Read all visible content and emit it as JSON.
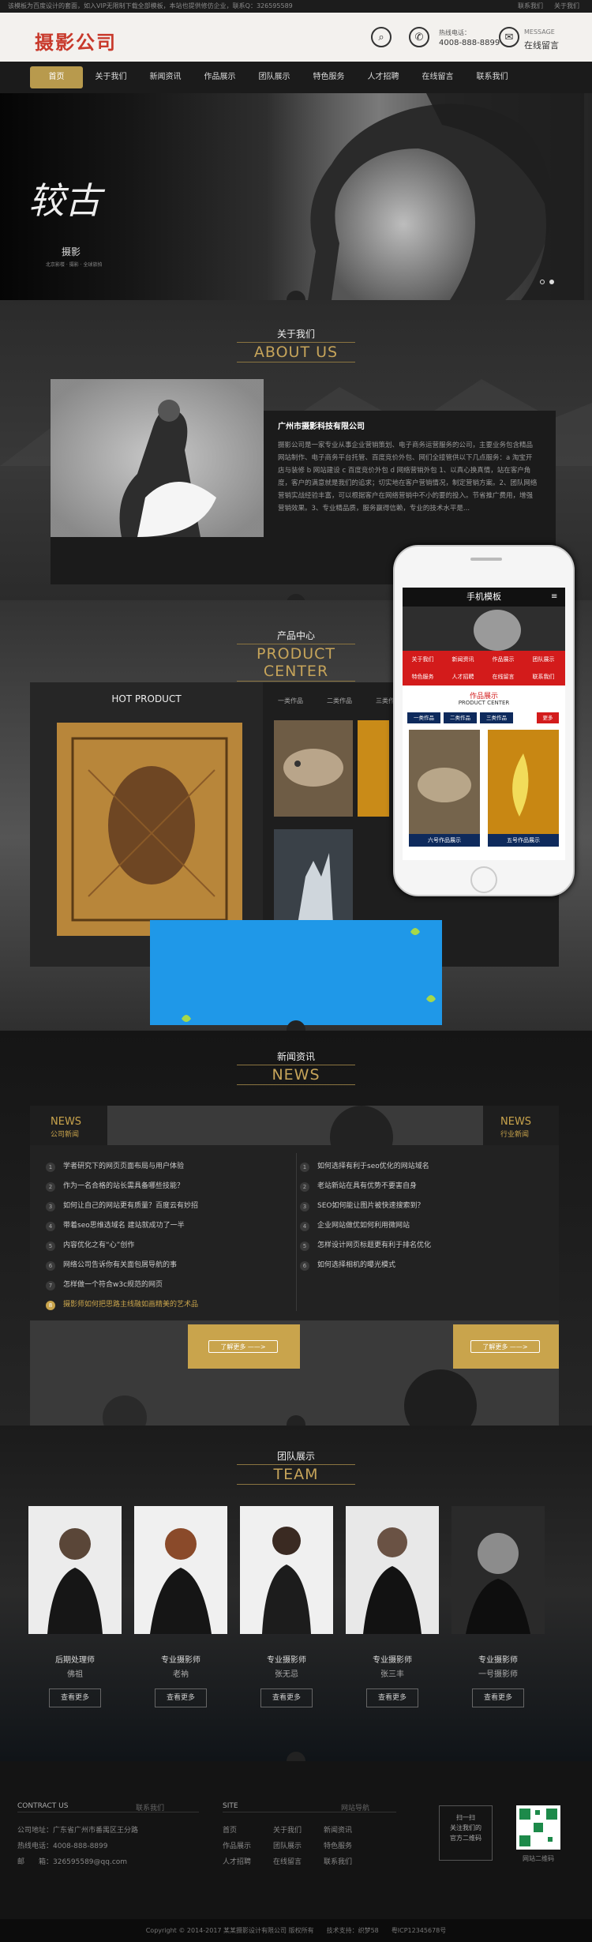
{
  "topbar": {
    "notice": "该模板为百度设计的套面，如入VIP无限制下载全部模板，本站也提供修仿企业，联系Q：326595589",
    "links": [
      "联系我们",
      "关于我们"
    ]
  },
  "header": {
    "logo": "摄影公司",
    "hotline_label": "热线电话：",
    "hotline": "4008-888-8899",
    "message_en": "MESSAGE",
    "message_cn": "在线留言"
  },
  "nav": [
    "首页",
    "关于我们",
    "新闻资讯",
    "作品展示",
    "团队展示",
    "特色服务",
    "人才招聘",
    "在线留言",
    "联系我们"
  ],
  "banner": {
    "calligraphy": "较古",
    "brand": "摄影",
    "sub": "北京影楼 · 摄影 · 全球旅拍"
  },
  "about": {
    "title_cn": "关于我们",
    "title_en": "ABOUT US",
    "company": "广州市摄影科技有限公司",
    "text": "摄影公司是一家专业从事企业营销策划、电子商务运营服务的公司，主要业务包含精品网站制作、电子商务平台托管、百度竞价外包、网们全接管供以下几点服务：a 淘宝开店与装修 b 网站建设 c 百度竞价外包 d 网络营销外包 1、以真心换真情，站在客户角度，客户的满意就是我们的追求；切实地在客户营销情况，制定营销方案。2、团队网络营销实战经验丰富，可以根据客户在网络营销中不小的要的投入。节省推广费用，增强营销效果。3、专业精品质，服务赢得信赖，专业的技术水平是..."
  },
  "products": {
    "title_cn": "产品中心",
    "title_en": "PRODUCT CENTER",
    "hot": "HOT PRODUCT",
    "tabs": [
      "一类作品",
      "二类作品",
      "三类作品"
    ]
  },
  "phone": {
    "title": "手机模板",
    "menu": [
      "关于我们",
      "新闻资讯",
      "作品展示",
      "团队展示",
      "特色服务",
      "人才招聘",
      "在线留言",
      "联系我们"
    ],
    "sec_cn": "作品展示",
    "sec_en": "PRODUCT CENTER",
    "tabs": [
      "一类作品",
      "二类作品",
      "三类作品",
      "更多"
    ],
    "captions": [
      "六号作品展示",
      "五号作品展示"
    ]
  },
  "news": {
    "title_cn": "新闻资讯",
    "title_en": "NEWS",
    "left_en": "NEWS",
    "left_cn": "公司新闻",
    "right_en": "NEWS",
    "right_cn": "行业新闻",
    "left": [
      "学者研究下的网页页面布局与用户体验",
      "作为一名合格的站长需具备哪些技能？",
      "如何让自己的网站更有质量？百度云有妙招",
      "带着seo思维选域名 建站就成功了一半",
      "内容优化之有“心”创作",
      "网络公司告诉你有关面包屑导航的事",
      "怎样做一个符合w3c规范的网页",
      "摄影师如何把思路主线融如画精美的艺术品"
    ],
    "right": [
      "如何选择有利于seo优化的网站域名",
      "老站新站在具有优势不要害自身",
      "SEO如何能让图片被快速搜索到？",
      "企业网站做优如何利用微网站",
      "怎样设计网页标题更有利于排名优化",
      "如何选择相机的曝光模式"
    ],
    "more": "了解更多 ——>"
  },
  "team": {
    "title_cn": "团队展示",
    "title_en": "TEAM",
    "members": [
      {
        "title": "后期处理师",
        "name": "佛祖",
        "btn": "查看更多"
      },
      {
        "title": "专业摄影师",
        "name": "老衲",
        "btn": "查看更多"
      },
      {
        "title": "专业摄影师",
        "name": "张无忌",
        "btn": "查看更多"
      },
      {
        "title": "专业摄影师",
        "name": "张三丰",
        "btn": "查看更多"
      },
      {
        "title": "专业摄影师",
        "name": "一号摄影师",
        "btn": "查看更多"
      }
    ]
  },
  "footer": {
    "contact_h": "CONTRACT US",
    "contact_g": "联系我们",
    "address": "公司地址：广东省广州市番禺区王分路",
    "phone": "热线电话：4008-888-8899",
    "email": "邮　　箱：326595589@qq.com",
    "site_h": "SITE",
    "site_g": "网站导航",
    "links": [
      "首页",
      "关于我们",
      "新闻资讯",
      "作品展示",
      "团队展示",
      "特色服务",
      "人才招聘",
      "在线留言",
      "联系我们"
    ],
    "scan": "扫一扫\n关注我们的\n官方二维码",
    "qr_label": "网站二维码"
  },
  "copyright": "Copyright © 2014-2017 某某摄影设计有限公司 版权所有　　技术支持：织梦58　　粤ICP12345678号",
  "colors": {
    "gold": "#c9a44c",
    "red": "#c8392b",
    "dark": "#1b1b1b"
  }
}
